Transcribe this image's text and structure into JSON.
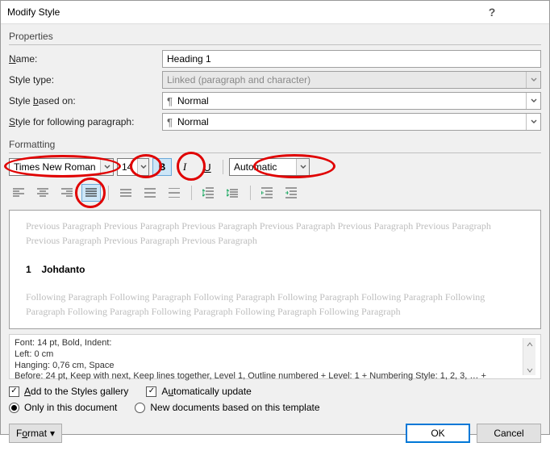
{
  "title": "Modify Style",
  "sections": {
    "properties": "Properties",
    "formatting": "Formatting"
  },
  "labels": {
    "name_pre": "",
    "name_u": "N",
    "name_post": "ame:",
    "type": "Style type:",
    "based_pre": "Style ",
    "based_u": "b",
    "based_post": "ased on:",
    "follow_pre": "",
    "follow_u": "S",
    "follow_post": "tyle for following paragraph:"
  },
  "fields": {
    "name": "Heading 1",
    "type": "Linked (paragraph and character)",
    "based_on": "Normal",
    "following": "Normal"
  },
  "font": {
    "family": "Times New Roman",
    "size": "14",
    "bold_label": "B",
    "italic_label": "I",
    "underline_label": "U",
    "color": "Automatic"
  },
  "preview": {
    "before": "Previous Paragraph Previous Paragraph Previous Paragraph Previous Paragraph Previous Paragraph Previous Paragraph Previous Paragraph Previous Paragraph Previous Paragraph",
    "heading_n": "1",
    "heading_t": "Johdanto",
    "after": "Following Paragraph Following Paragraph Following Paragraph Following Paragraph Following Paragraph Following Paragraph Following Paragraph Following Paragraph Following Paragraph Following Paragraph"
  },
  "desc": "Font: 14 pt, Bold, Indent:\n    Left:  0 cm\n    Hanging:  0,76 cm, Space\n    Before:  24 pt, Keep with next, Keep lines together, Level 1, Outline numbered + Level: 1 + Numbering Style: 1, 2, 3, … +",
  "checks": {
    "gallery_pre": "",
    "gallery_u": "A",
    "gallery_post": "dd to the Styles gallery",
    "auto_pre": "A",
    "auto_u": "u",
    "auto_post": "tomatically update"
  },
  "radios": {
    "only": "Only in this document",
    "new": "New documents based on this template"
  },
  "buttons": {
    "format_pre": "F",
    "format_u": "o",
    "format_post": "rmat",
    "ok": "OK",
    "cancel": "Cancel"
  }
}
